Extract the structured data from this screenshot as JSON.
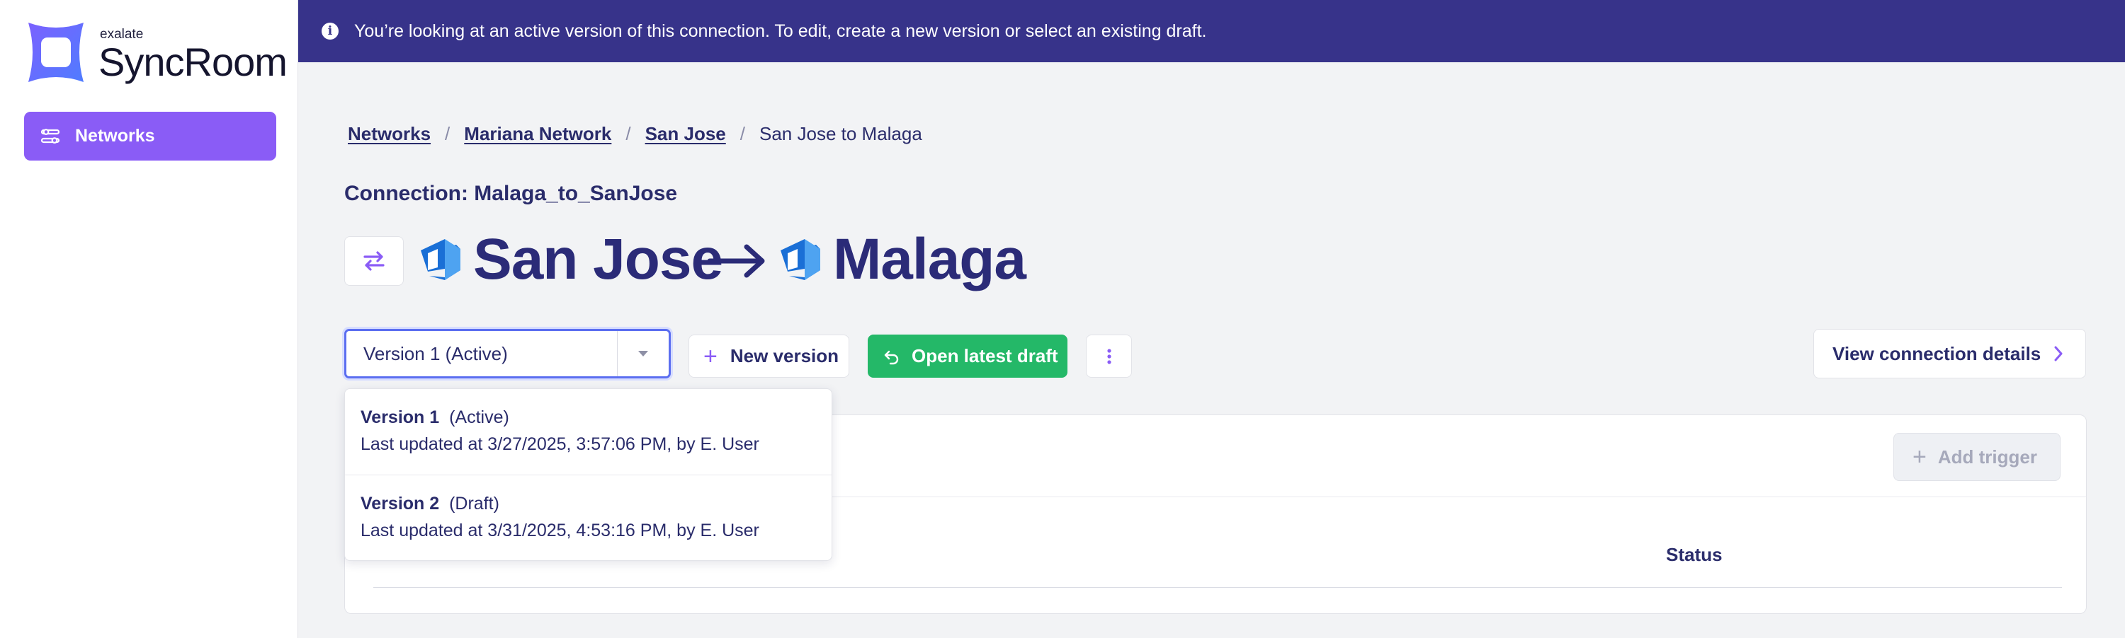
{
  "brand": {
    "small": "exalate",
    "name": "SyncRoom"
  },
  "sidebar": {
    "items": [
      {
        "label": "Networks",
        "icon": "sliders-icon"
      }
    ]
  },
  "banner": {
    "text": "You’re looking at an active version of this connection. To edit, create a new version or select an existing draft.",
    "icon": "info-icon"
  },
  "breadcrumb": {
    "items": [
      "Networks",
      "Mariana Network",
      "San Jose"
    ],
    "separator": "/",
    "current": "San Jose to Malaga"
  },
  "connection": {
    "label": "Connection: Malaga_to_SanJose",
    "source": "San Jose",
    "target": "Malaga"
  },
  "toolbar": {
    "version_selected": "Version 1 (Active)",
    "new_version_label": "New version",
    "open_draft_label": "Open latest draft",
    "view_details_label": "View connection details"
  },
  "dropdown": {
    "options": [
      {
        "name": "Version 1",
        "state": "(Active)",
        "updated": "Last updated at 3/27/2025, 3:57:06 PM, by E. User"
      },
      {
        "name": "Version 2",
        "state": "(Draft)",
        "updated": "Last updated at 3/31/2025, 4:53:16 PM, by E. User"
      }
    ]
  },
  "card": {
    "add_trigger_label": "Add trigger",
    "status_header": "Status"
  },
  "colors": {
    "banner": "#37338a",
    "accent": "#8a5cf6",
    "primary_text": "#2a2c6b",
    "success": "#24b868"
  }
}
